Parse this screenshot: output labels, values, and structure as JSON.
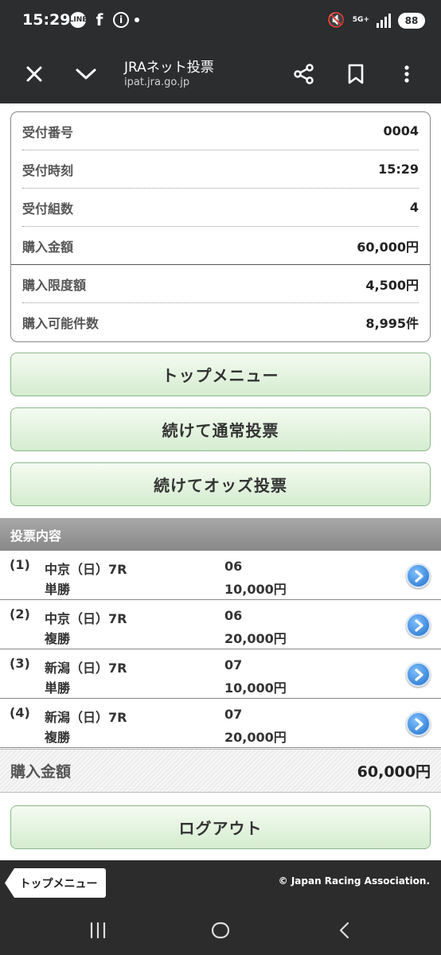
{
  "status_bar": {
    "time": "15:29",
    "network": "5G+",
    "battery": "88"
  },
  "browser": {
    "title": "JRAネット投票",
    "url": "ipat.jra.go.jp"
  },
  "receipt": {
    "rows": [
      {
        "label": "受付番号",
        "value": "0004"
      },
      {
        "label": "受付時刻",
        "value": "15:29"
      },
      {
        "label": "受付組数",
        "value": "4"
      },
      {
        "label": "購入金額",
        "value": "60,000円"
      },
      {
        "label": "購入限度額",
        "value": "4,500円"
      },
      {
        "label": "購入可能件数",
        "value": "8,995件"
      }
    ]
  },
  "buttons": {
    "top_menu": "トップメニュー",
    "continue_normal": "続けて通常投票",
    "continue_odds": "続けてオッズ投票",
    "logout": "ログアウト"
  },
  "bets_section": {
    "heading": "投票内容",
    "items": [
      {
        "num": "(1)",
        "race": "中京（日）7R",
        "type": "単勝",
        "horse": "06",
        "amount": "10,000円"
      },
      {
        "num": "(2)",
        "race": "中京（日）7R",
        "type": "複勝",
        "horse": "06",
        "amount": "20,000円"
      },
      {
        "num": "(3)",
        "race": "新潟（日）7R",
        "type": "単勝",
        "horse": "07",
        "amount": "10,000円"
      },
      {
        "num": "(4)",
        "race": "新潟（日）7R",
        "type": "複勝",
        "horse": "07",
        "amount": "20,000円"
      }
    ]
  },
  "total": {
    "label": "購入金額",
    "value": "60,000円"
  },
  "footer": {
    "back_label": "トップメニュー",
    "copyright": "© Japan Racing Association."
  }
}
